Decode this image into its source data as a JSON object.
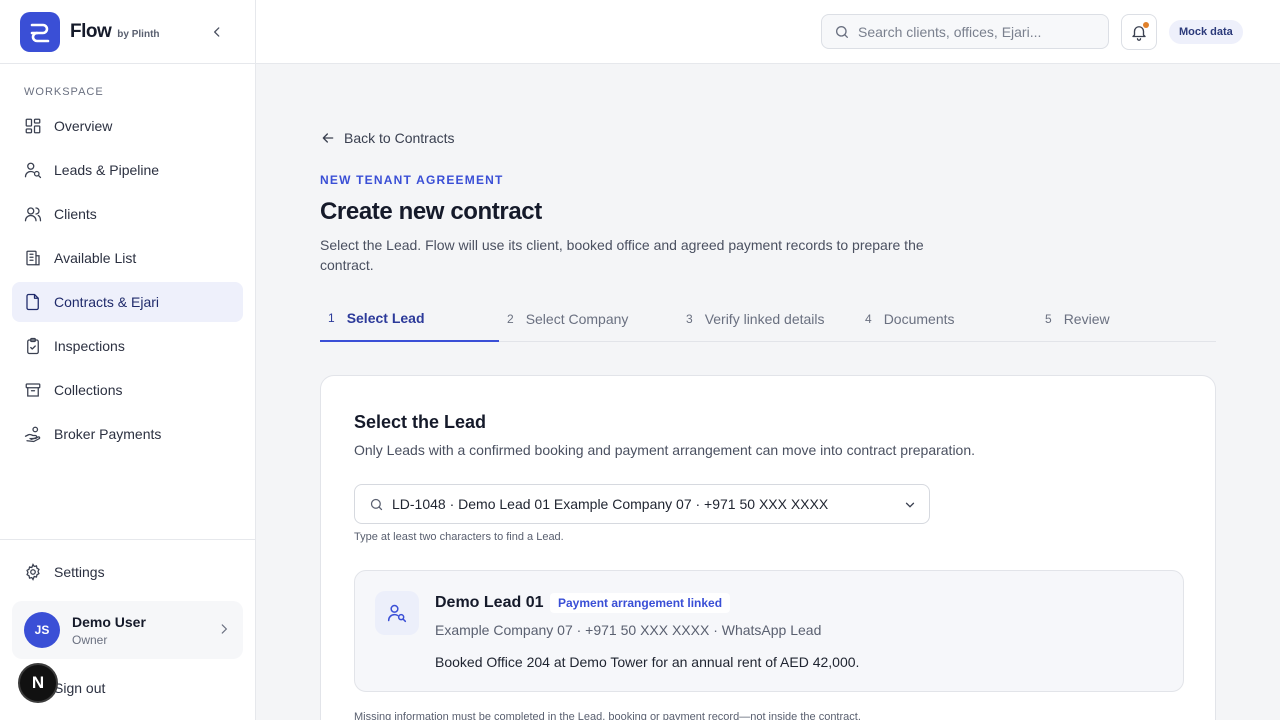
{
  "brand": {
    "name": "Flow",
    "sub": "by Plinth"
  },
  "sidebar": {
    "section_label": "WORKSPACE",
    "items": [
      {
        "label": "Overview",
        "icon": "grid-icon"
      },
      {
        "label": "Leads & Pipeline",
        "icon": "user-search-icon"
      },
      {
        "label": "Clients",
        "icon": "users-icon"
      },
      {
        "label": "Available List",
        "icon": "building-icon"
      },
      {
        "label": "Contracts & Ejari",
        "icon": "document-icon"
      },
      {
        "label": "Inspections",
        "icon": "clipboard-check-icon"
      },
      {
        "label": "Collections",
        "icon": "archive-icon"
      },
      {
        "label": "Broker Payments",
        "icon": "hand-coins-icon"
      }
    ],
    "active_index": 4,
    "settings_label": "Settings",
    "user": {
      "initials": "JS",
      "name": "Demo User",
      "role": "Owner"
    },
    "signout_label": "Sign out",
    "badge_letter": "N"
  },
  "topbar": {
    "search_placeholder": "Search clients, offices, Ejari...",
    "mock_label": "Mock data"
  },
  "page": {
    "back_label": "Back to Contracts",
    "eyebrow": "NEW TENANT AGREEMENT",
    "title": "Create new contract",
    "description": "Select the Lead. Flow will use its client, booked office and agreed payment records to prepare the contract."
  },
  "steps": [
    {
      "num": "1",
      "label": "Select Lead"
    },
    {
      "num": "2",
      "label": "Select Company"
    },
    {
      "num": "3",
      "label": "Verify linked details"
    },
    {
      "num": "4",
      "label": "Documents"
    },
    {
      "num": "5",
      "label": "Review"
    }
  ],
  "card": {
    "title": "Select the Lead",
    "subtitle": "Only Leads with a confirmed booking and payment arrangement can move into contract preparation.",
    "selected_value": "LD-1048 · Demo Lead 01 Example Company 07 · +971 50 XXX XXXX",
    "hint": "Type at least two characters to find a Lead.",
    "lead": {
      "name": "Demo Lead 01",
      "badge": "Payment arrangement linked",
      "meta": "Example Company 07 · +971 50 XXX XXXX · WhatsApp Lead",
      "note": "Booked Office 204 at Demo Tower for an annual rent of AED 42,000."
    },
    "footnote": "Missing information must be completed in the Lead, booking or payment record—not inside the contract."
  },
  "colors": {
    "accent": "#3a4fd6",
    "active_bg": "#eef0fb",
    "notification": "#e0802a"
  }
}
